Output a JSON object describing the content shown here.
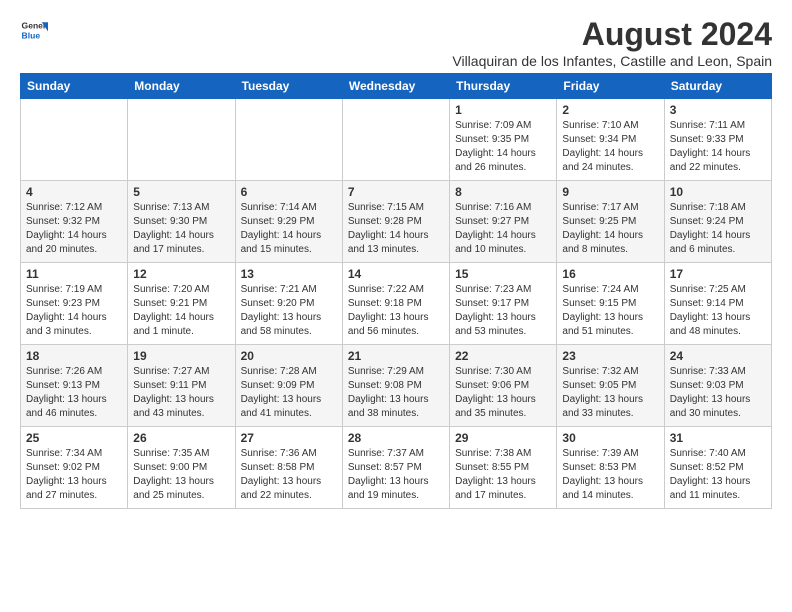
{
  "header": {
    "logo_line1": "General",
    "logo_line2": "Blue",
    "title": "August 2024",
    "subtitle": "Villaquiran de los Infantes, Castille and Leon, Spain"
  },
  "weekdays": [
    "Sunday",
    "Monday",
    "Tuesday",
    "Wednesday",
    "Thursday",
    "Friday",
    "Saturday"
  ],
  "weeks": [
    [
      {
        "day": "",
        "info": ""
      },
      {
        "day": "",
        "info": ""
      },
      {
        "day": "",
        "info": ""
      },
      {
        "day": "",
        "info": ""
      },
      {
        "day": "1",
        "info": "Sunrise: 7:09 AM\nSunset: 9:35 PM\nDaylight: 14 hours\nand 26 minutes."
      },
      {
        "day": "2",
        "info": "Sunrise: 7:10 AM\nSunset: 9:34 PM\nDaylight: 14 hours\nand 24 minutes."
      },
      {
        "day": "3",
        "info": "Sunrise: 7:11 AM\nSunset: 9:33 PM\nDaylight: 14 hours\nand 22 minutes."
      }
    ],
    [
      {
        "day": "4",
        "info": "Sunrise: 7:12 AM\nSunset: 9:32 PM\nDaylight: 14 hours\nand 20 minutes."
      },
      {
        "day": "5",
        "info": "Sunrise: 7:13 AM\nSunset: 9:30 PM\nDaylight: 14 hours\nand 17 minutes."
      },
      {
        "day": "6",
        "info": "Sunrise: 7:14 AM\nSunset: 9:29 PM\nDaylight: 14 hours\nand 15 minutes."
      },
      {
        "day": "7",
        "info": "Sunrise: 7:15 AM\nSunset: 9:28 PM\nDaylight: 14 hours\nand 13 minutes."
      },
      {
        "day": "8",
        "info": "Sunrise: 7:16 AM\nSunset: 9:27 PM\nDaylight: 14 hours\nand 10 minutes."
      },
      {
        "day": "9",
        "info": "Sunrise: 7:17 AM\nSunset: 9:25 PM\nDaylight: 14 hours\nand 8 minutes."
      },
      {
        "day": "10",
        "info": "Sunrise: 7:18 AM\nSunset: 9:24 PM\nDaylight: 14 hours\nand 6 minutes."
      }
    ],
    [
      {
        "day": "11",
        "info": "Sunrise: 7:19 AM\nSunset: 9:23 PM\nDaylight: 14 hours\nand 3 minutes."
      },
      {
        "day": "12",
        "info": "Sunrise: 7:20 AM\nSunset: 9:21 PM\nDaylight: 14 hours\nand 1 minute."
      },
      {
        "day": "13",
        "info": "Sunrise: 7:21 AM\nSunset: 9:20 PM\nDaylight: 13 hours\nand 58 minutes."
      },
      {
        "day": "14",
        "info": "Sunrise: 7:22 AM\nSunset: 9:18 PM\nDaylight: 13 hours\nand 56 minutes."
      },
      {
        "day": "15",
        "info": "Sunrise: 7:23 AM\nSunset: 9:17 PM\nDaylight: 13 hours\nand 53 minutes."
      },
      {
        "day": "16",
        "info": "Sunrise: 7:24 AM\nSunset: 9:15 PM\nDaylight: 13 hours\nand 51 minutes."
      },
      {
        "day": "17",
        "info": "Sunrise: 7:25 AM\nSunset: 9:14 PM\nDaylight: 13 hours\nand 48 minutes."
      }
    ],
    [
      {
        "day": "18",
        "info": "Sunrise: 7:26 AM\nSunset: 9:13 PM\nDaylight: 13 hours\nand 46 minutes."
      },
      {
        "day": "19",
        "info": "Sunrise: 7:27 AM\nSunset: 9:11 PM\nDaylight: 13 hours\nand 43 minutes."
      },
      {
        "day": "20",
        "info": "Sunrise: 7:28 AM\nSunset: 9:09 PM\nDaylight: 13 hours\nand 41 minutes."
      },
      {
        "day": "21",
        "info": "Sunrise: 7:29 AM\nSunset: 9:08 PM\nDaylight: 13 hours\nand 38 minutes."
      },
      {
        "day": "22",
        "info": "Sunrise: 7:30 AM\nSunset: 9:06 PM\nDaylight: 13 hours\nand 35 minutes."
      },
      {
        "day": "23",
        "info": "Sunrise: 7:32 AM\nSunset: 9:05 PM\nDaylight: 13 hours\nand 33 minutes."
      },
      {
        "day": "24",
        "info": "Sunrise: 7:33 AM\nSunset: 9:03 PM\nDaylight: 13 hours\nand 30 minutes."
      }
    ],
    [
      {
        "day": "25",
        "info": "Sunrise: 7:34 AM\nSunset: 9:02 PM\nDaylight: 13 hours\nand 27 minutes."
      },
      {
        "day": "26",
        "info": "Sunrise: 7:35 AM\nSunset: 9:00 PM\nDaylight: 13 hours\nand 25 minutes."
      },
      {
        "day": "27",
        "info": "Sunrise: 7:36 AM\nSunset: 8:58 PM\nDaylight: 13 hours\nand 22 minutes."
      },
      {
        "day": "28",
        "info": "Sunrise: 7:37 AM\nSunset: 8:57 PM\nDaylight: 13 hours\nand 19 minutes."
      },
      {
        "day": "29",
        "info": "Sunrise: 7:38 AM\nSunset: 8:55 PM\nDaylight: 13 hours\nand 17 minutes."
      },
      {
        "day": "30",
        "info": "Sunrise: 7:39 AM\nSunset: 8:53 PM\nDaylight: 13 hours\nand 14 minutes."
      },
      {
        "day": "31",
        "info": "Sunrise: 7:40 AM\nSunset: 8:52 PM\nDaylight: 13 hours\nand 11 minutes."
      }
    ]
  ]
}
